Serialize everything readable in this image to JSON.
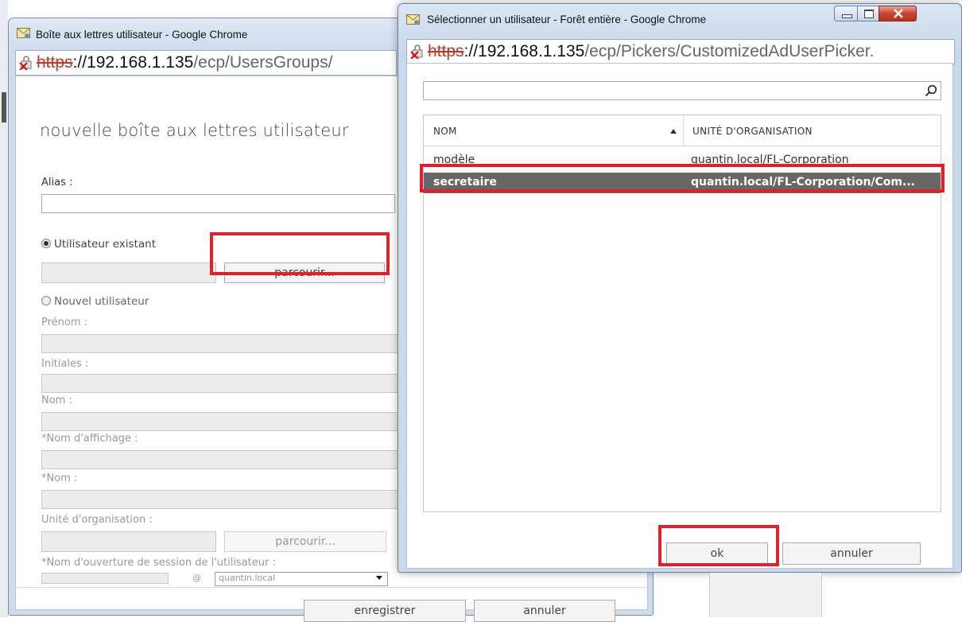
{
  "back_window": {
    "title": "Boîte aux lettres utilisateur - Google Chrome",
    "url_proto": "https",
    "url_host": "://192.168.1.135",
    "url_path": "/ecp/UsersGroups/",
    "heading": "nouvelle boîte aux lettres utilisateur",
    "alias_label": "Alias :",
    "existing_user_label": "Utilisateur existant",
    "browse_label": "parcourir...",
    "new_user_label": "Nouvel utilisateur",
    "first_name_label": "Prénom :",
    "initials_label": "Initiales :",
    "last_name_label": "Nom :",
    "display_name_label": "*Nom d'affichage :",
    "name_label": "*Nom :",
    "org_unit_label": "Unité d'organisation :",
    "org_browse_label": "parcourir...",
    "logon_label": "*Nom d'ouverture de session de l'utilisateur :",
    "at_sign": "@",
    "domain_value": "quantin.local",
    "save_label": "enregistrer",
    "cancel_label": "annuler"
  },
  "front_window": {
    "title": "Sélectionner un utilisateur - Forêt entière - Google Chrome",
    "url_proto": "https",
    "url_host": "://192.168.1.135",
    "url_path": "/ecp/Pickers/CustomizedAdUserPicker.",
    "columns": {
      "name": "NOM",
      "org_unit": "UNITÉ D'ORGANISATION"
    },
    "rows": [
      {
        "name": "modèle",
        "org_unit": "quantin.local/FL-Corporation"
      },
      {
        "name": "secretaire",
        "org_unit": "quantin.local/FL-Corporation/Com..."
      }
    ],
    "ok_label": "ok",
    "cancel_label": "annuler"
  },
  "colors": {
    "highlight": "#e0202a",
    "selected_row": "#676767"
  }
}
